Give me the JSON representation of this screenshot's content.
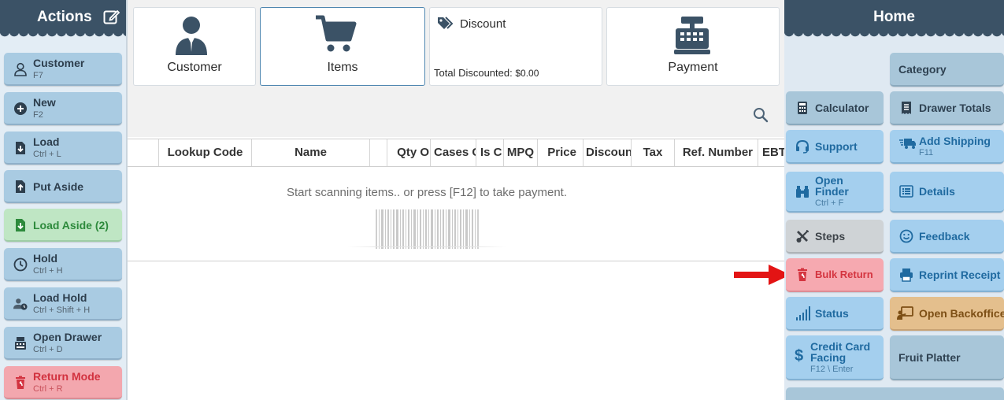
{
  "left_panel": {
    "title": "Actions",
    "buttons": [
      {
        "label": "Customer",
        "shortcut": "F7"
      },
      {
        "label": "New",
        "shortcut": "F2"
      },
      {
        "label": "Load",
        "shortcut": "Ctrl + L"
      },
      {
        "label": "Put Aside",
        "shortcut": ""
      },
      {
        "label": "Load Aside (2)",
        "shortcut": ""
      },
      {
        "label": "Hold",
        "shortcut": "Ctrl + H"
      },
      {
        "label": "Load Hold",
        "shortcut": "Ctrl + Shift + H"
      },
      {
        "label": "Open Drawer",
        "shortcut": "Ctrl + D"
      },
      {
        "label": "Return Mode",
        "shortcut": "Ctrl + R"
      }
    ]
  },
  "tiles": {
    "customer": "Customer",
    "items": "Items",
    "discount_title": "Discount",
    "discount_label": "Total Discounted:",
    "discount_value": "$0.00",
    "payment": "Payment"
  },
  "table": {
    "columns": [
      "",
      "Lookup Code",
      "Name",
      "",
      "Qty O",
      "Cases C",
      "Is C",
      "MPQ",
      "Price",
      "Discoun",
      "Tax",
      "Ref. Number",
      "EBT"
    ],
    "empty_message": "Start scanning items.. or press [F12] to take payment."
  },
  "right_panel": {
    "title": "Home",
    "buttons": {
      "category": "Category",
      "calculator": "Calculator",
      "drawer_totals": "Drawer Totals",
      "support": "Support",
      "add_shipping": "Add Shipping",
      "add_shipping_sc": "F11",
      "open_finder_1": "Open",
      "open_finder_2": "Finder",
      "open_finder_sc": "Ctrl + F",
      "details": "Details",
      "steps": "Steps",
      "feedback": "Feedback",
      "bulk_return": "Bulk Return",
      "reprint_receipt": "Reprint Receipt",
      "status": "Status",
      "open_backoffice": "Open Backoffice",
      "cc_facing_1": "Credit Card",
      "cc_facing_2": "Facing",
      "cc_facing_sc": "F12 \\ Enter",
      "fruit_platter": "Fruit Platter"
    }
  },
  "colors": {
    "header_bg": "#3b5266",
    "accent_blue": "#1f6aa0",
    "return_red": "#d4343f",
    "aside_green": "#2d8a3c",
    "arrow_red": "#e31414"
  }
}
